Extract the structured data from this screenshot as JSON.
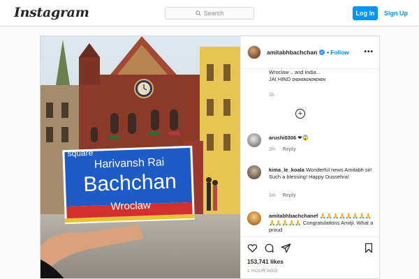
{
  "nav": {
    "logo": "Instagram",
    "search_placeholder": "Search",
    "login_label": "Log In",
    "signup_label": "Sign Up"
  },
  "post": {
    "username": "amitabhbachchan",
    "follow_label": "Follow",
    "sign": {
      "line1": "square",
      "line2": "Harivansh Rai",
      "line3": "Bachchan",
      "line4": "Wroclaw"
    },
    "caption": {
      "line1": "Wroclaw .. and India ..",
      "line2": "JAI HIND ɪɴɪɴɪɴɪɴɪɴɪɴɪɴ",
      "time": "1h"
    },
    "comments": [
      {
        "username": "arushi0306",
        "text": "❤😱",
        "time": "2m",
        "reply_label": "Reply"
      },
      {
        "username": "kima_le_koala",
        "text": "Wonderful news Amitabh sir! Such a blessing! Happy Dussehra!",
        "time": "1m",
        "reply_label": "Reply"
      },
      {
        "username": "amitabhbachchanef",
        "text": "🙏🙏🙏🙏🙏🙏🙏🙏🙏🙏🙏🙏🙏 Congratulations Amitji. What a proud",
        "time": "",
        "reply_label": ""
      }
    ],
    "likes": "153,741 likes",
    "timestamp": "1 HOUR AGO"
  },
  "colors": {
    "accent": "#0095f6",
    "verified": "#3897f0",
    "sign_blue": "#1e5bc6",
    "sign_red": "#d32f2f",
    "brick": "#8b3a2a"
  },
  "icons": [
    "search-icon",
    "verified-badge-icon",
    "more-options-icon",
    "load-more-icon",
    "heart-icon",
    "comment-icon",
    "share-icon",
    "bookmark-icon"
  ]
}
